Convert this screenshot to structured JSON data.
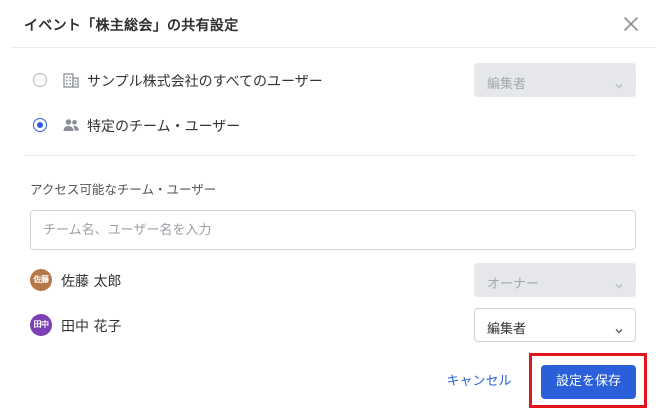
{
  "dialog": {
    "title": "イベント「株主総会」の共有設定",
    "close_icon": "close-icon"
  },
  "options": [
    {
      "label": "サンプル株式会社のすべてのユーザー",
      "icon": "building-icon",
      "selected": false,
      "permission": "編集者",
      "permission_disabled": true
    },
    {
      "label": "特定のチーム・ユーザー",
      "icon": "users-icon",
      "selected": true
    }
  ],
  "access": {
    "section_label": "アクセス可能なチーム・ユーザー",
    "search_placeholder": "チーム名、ユーザー名を入力",
    "search_value": ""
  },
  "users": [
    {
      "avatar_text": "佐藤",
      "avatar_color": "#b5784a",
      "name": "佐藤 太郎",
      "permission": "オーナー",
      "disabled": true
    },
    {
      "avatar_text": "田中",
      "avatar_color": "#7a3fb0",
      "name": "田中 花子",
      "permission": "編集者",
      "disabled": false
    }
  ],
  "footer": {
    "cancel_label": "キャンセル",
    "save_label": "設定を保存"
  },
  "colors": {
    "accent": "#2b5fd9",
    "highlight": "#e2141c"
  }
}
